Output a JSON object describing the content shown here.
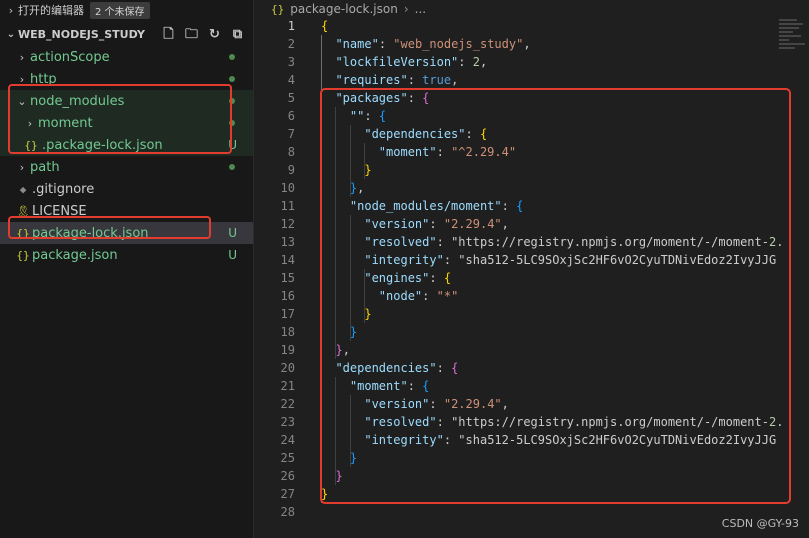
{
  "sidebar": {
    "open_editors_label": "打开的编辑器",
    "unsaved_badge": "2 个未保存",
    "folder_name": "WEB_NODEJS_STUDY",
    "items": [
      {
        "label": "actionScope"
      },
      {
        "label": "http"
      },
      {
        "label": "node_modules"
      },
      {
        "label": "moment"
      },
      {
        "label": ".package-lock.json",
        "status": "U"
      },
      {
        "label": "path"
      },
      {
        "label": ".gitignore"
      },
      {
        "label": "LICENSE"
      },
      {
        "label": "package-lock.json",
        "status": "U"
      },
      {
        "label": "package.json",
        "status": "U"
      }
    ]
  },
  "editor": {
    "breadcrumb_file": "package-lock.json",
    "breadcrumb_more": "...",
    "lines": [
      {
        "n": "1",
        "t": "{"
      },
      {
        "n": "2",
        "t": "  \"name\": \"web_nodejs_study\","
      },
      {
        "n": "3",
        "t": "  \"lockfileVersion\": 2,"
      },
      {
        "n": "4",
        "t": "  \"requires\": true,"
      },
      {
        "n": "5",
        "t": "  \"packages\": {"
      },
      {
        "n": "6",
        "t": "    \"\": {"
      },
      {
        "n": "7",
        "t": "      \"dependencies\": {"
      },
      {
        "n": "8",
        "t": "        \"moment\": \"^2.29.4\""
      },
      {
        "n": "9",
        "t": "      }"
      },
      {
        "n": "10",
        "t": "    },"
      },
      {
        "n": "11",
        "t": "    \"node_modules/moment\": {"
      },
      {
        "n": "12",
        "t": "      \"version\": \"2.29.4\","
      },
      {
        "n": "13",
        "t": "      \"resolved\": \"https://registry.npmjs.org/moment/-/moment-2."
      },
      {
        "n": "14",
        "t": "      \"integrity\": \"sha512-5LC9SOxjSc2HF6vO2CyuTDNivEdoz2IvyJJG"
      },
      {
        "n": "15",
        "t": "      \"engines\": {"
      },
      {
        "n": "16",
        "t": "        \"node\": \"*\""
      },
      {
        "n": "17",
        "t": "      }"
      },
      {
        "n": "18",
        "t": "    }"
      },
      {
        "n": "19",
        "t": "  },"
      },
      {
        "n": "20",
        "t": "  \"dependencies\": {"
      },
      {
        "n": "21",
        "t": "    \"moment\": {"
      },
      {
        "n": "22",
        "t": "      \"version\": \"2.29.4\","
      },
      {
        "n": "23",
        "t": "      \"resolved\": \"https://registry.npmjs.org/moment/-/moment-2."
      },
      {
        "n": "24",
        "t": "      \"integrity\": \"sha512-5LC9SOxjSc2HF6vO2CyuTDNivEdoz2IvyJJG"
      },
      {
        "n": "25",
        "t": "    }"
      },
      {
        "n": "26",
        "t": "  }"
      },
      {
        "n": "27",
        "t": "}"
      },
      {
        "n": "28",
        "t": ""
      }
    ]
  },
  "watermark": "CSDN @GY-93",
  "colors": {
    "highlight_box": "#e13c2d",
    "untracked_green": "#73c991",
    "json_key": "#9cdcfe",
    "json_string": "#ce9178"
  },
  "icons": {
    "json_file": "braces-icon",
    "license": "license-icon",
    "gitignore": "git-icon"
  }
}
